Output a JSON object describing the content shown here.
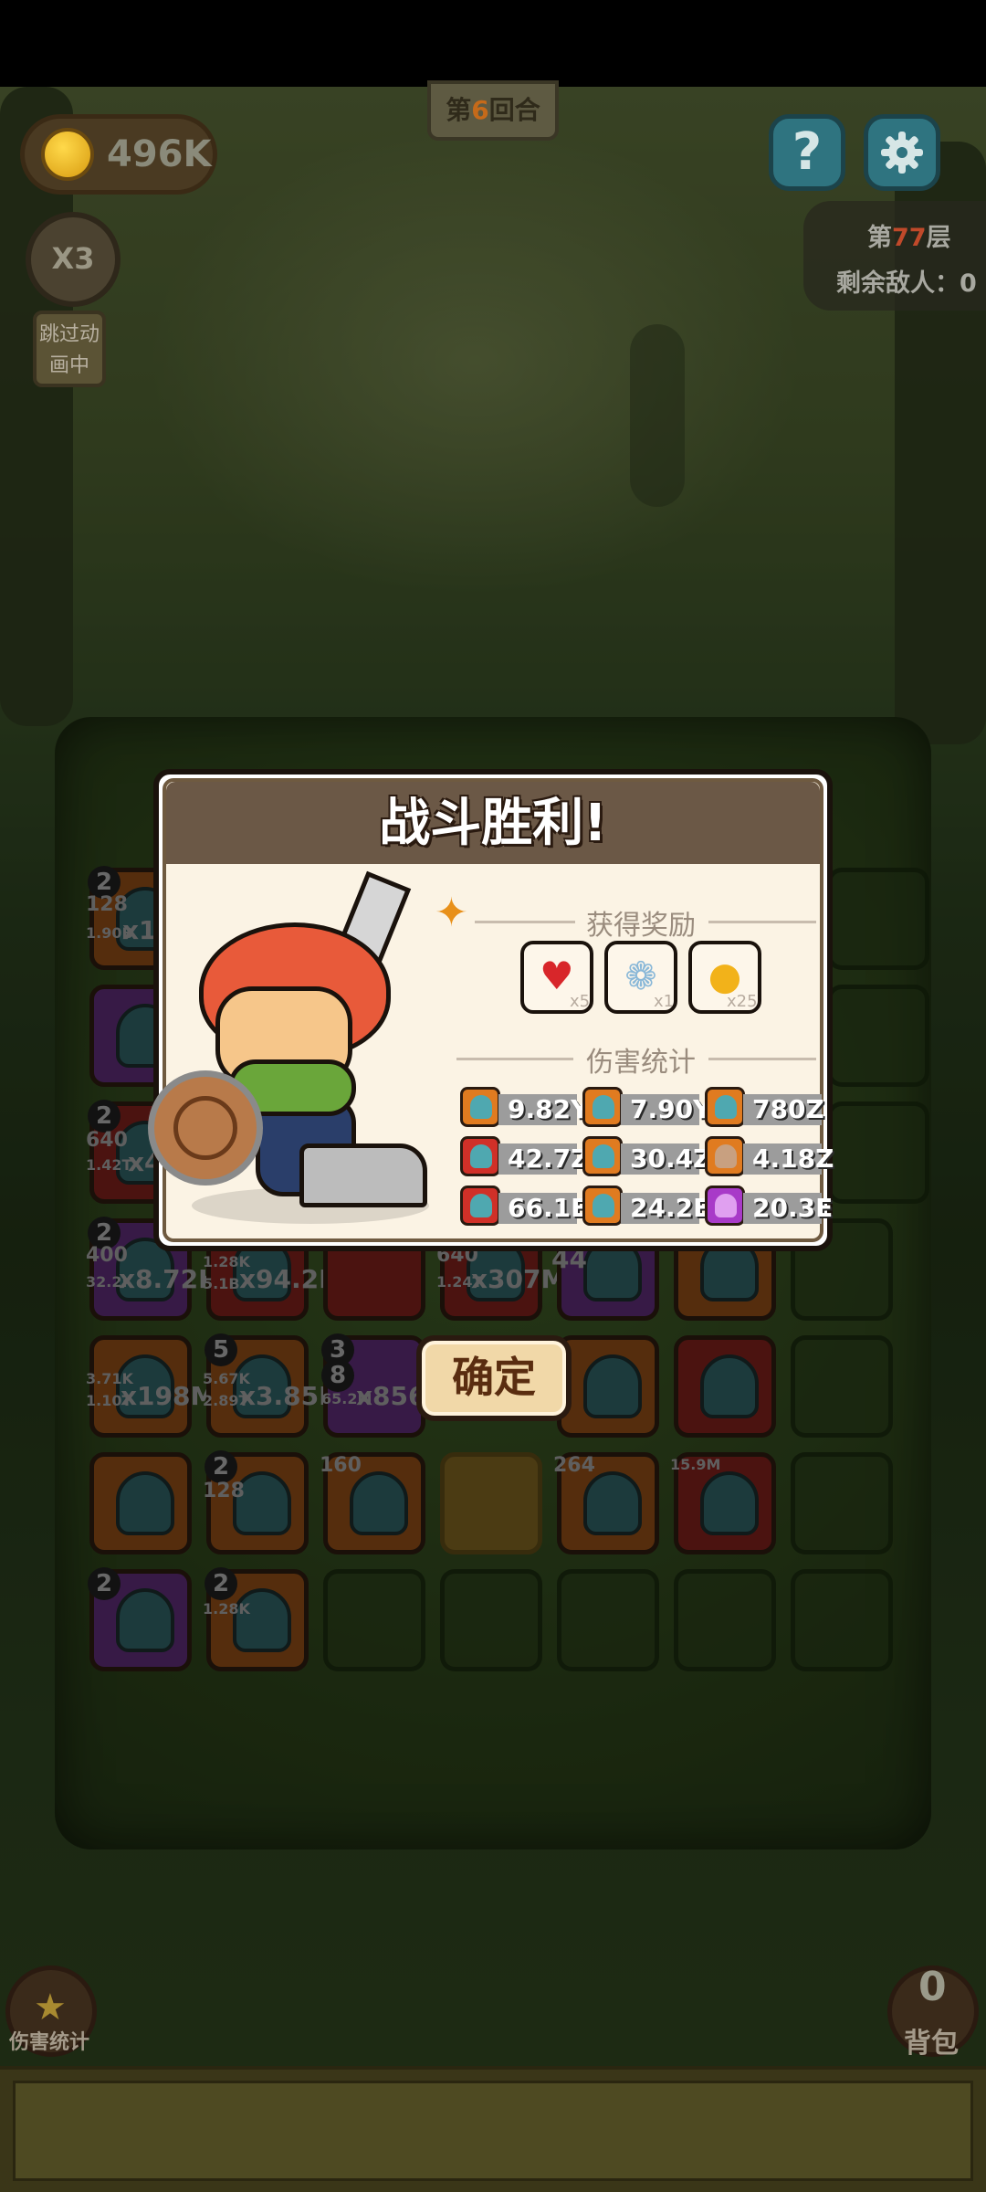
{
  "hud": {
    "coins": "496K",
    "round_prefix": "第",
    "round_number": "6",
    "round_suffix": "回合",
    "help_icon": "?",
    "speed": "X3",
    "skip_label": "跳过动画中",
    "floor_prefix": "第",
    "floor_number": "77",
    "floor_suffix": "层",
    "enemies_remaining": "剩余敌人：0"
  },
  "board": {
    "tiles": [
      {
        "level": "2",
        "stat_top": "128",
        "stat_small": "1.90B",
        "stat_mult": "x1"
      },
      {
        "level": "2",
        "stat_top": "640",
        "stat_small": "1.42T",
        "stat_mult": "x4"
      },
      {
        "level": "2",
        "stat_top": "400",
        "stat_small": "32.2K",
        "stat_mult": "x8.72K"
      },
      {
        "stat_small": "1.28K",
        "stat_small2": "5.1B",
        "stat_mult": "x94.2K"
      },
      {
        "stat_top": "640",
        "stat_small": "1.24T",
        "stat_mult": "x307M"
      },
      {
        "stat_top": "44"
      },
      {
        "stat_small": "3.71K",
        "stat_small2": "1.10T",
        "stat_mult": "x198M"
      },
      {
        "level": "5",
        "stat_small": "5.67K",
        "stat_small2": "2.89T",
        "stat_mult": "x3.85B"
      },
      {
        "level": "3",
        "level2": "8",
        "stat_small": "65.2M",
        "stat_mult": "x856"
      },
      {
        "level": "2",
        "stat_top": "128"
      },
      {
        "stat_top": "160"
      },
      {
        "stat_top": "264"
      },
      {
        "stat_small": "15.9M"
      },
      {
        "level": "2"
      },
      {
        "level": "2",
        "stat_small": "1.28K"
      }
    ]
  },
  "dialog": {
    "title": "战斗胜利!",
    "rewards_label": "获得奖励",
    "rewards": [
      {
        "icon": "heart-icon",
        "count": "x5"
      },
      {
        "icon": "shell-icon",
        "count": "x1"
      },
      {
        "icon": "coin-icon",
        "count": "x25"
      }
    ],
    "damage_label": "伤害统计",
    "damage": [
      "9.82Y",
      "7.90Y",
      "780Z",
      "42.7Z",
      "30.4Z",
      "4.18Z",
      "66.1E",
      "24.2E",
      "20.3E"
    ],
    "confirm": "确定"
  },
  "bottom": {
    "damage_stats": "伤害统计",
    "bag_count": "0",
    "bag_label": "背包"
  }
}
